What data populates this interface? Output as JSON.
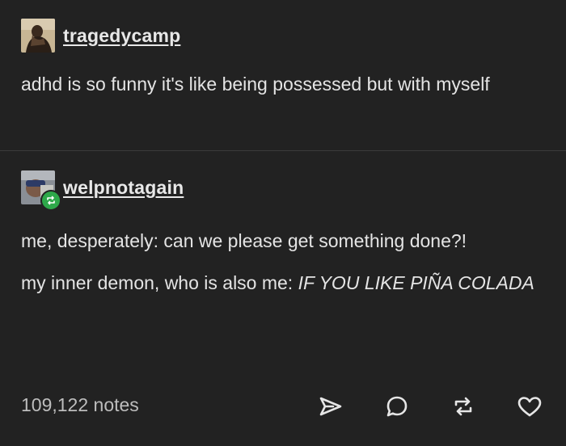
{
  "original_post": {
    "username": "tragedycamp",
    "text": "adhd is so funny it's like being possessed but with myself"
  },
  "reblog": {
    "username": "welpnotagain",
    "line1": "me, desperately: can we please get something done?!",
    "line2_prefix": "my inner demon, who is also me: ",
    "line2_italic": "IF YOU LIKE PIÑA COLADA"
  },
  "footer": {
    "notes": "109,122 notes"
  },
  "icons": {
    "share": "share-icon",
    "reply": "reply-icon",
    "reblog": "reblog-icon",
    "like": "heart-icon"
  },
  "colors": {
    "background": "#222222",
    "text": "#e4e4e4",
    "reblog_badge": "#2ea84a"
  }
}
